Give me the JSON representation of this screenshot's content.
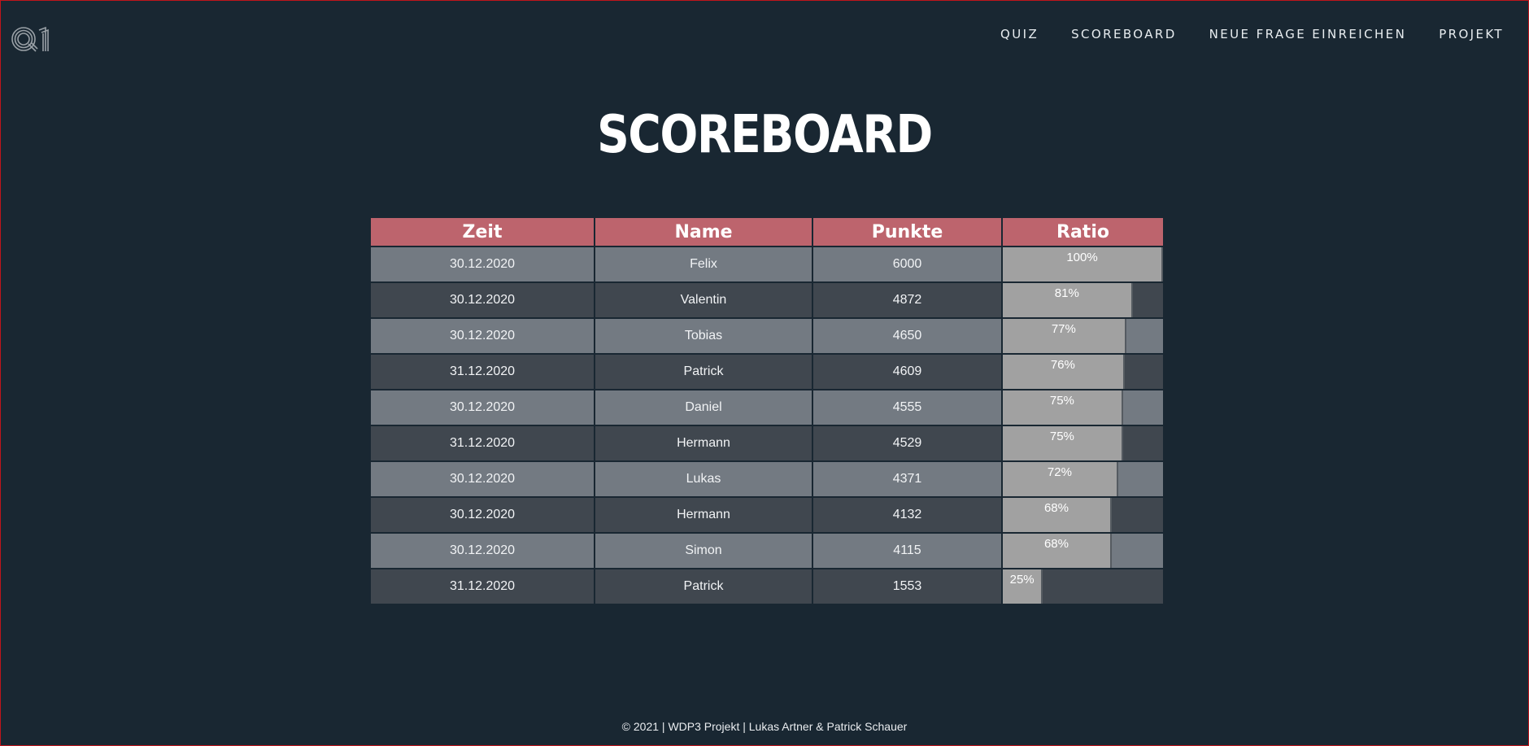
{
  "nav": {
    "logo_text": "Q1",
    "items": [
      {
        "label": "QUIZ"
      },
      {
        "label": "SCOREBOARD"
      },
      {
        "label": "NEUE FRAGE EINREICHEN"
      },
      {
        "label": "PROJEKT"
      }
    ]
  },
  "page": {
    "title": "SCOREBOARD"
  },
  "table": {
    "headers": [
      "Zeit",
      "Name",
      "Punkte",
      "Ratio"
    ],
    "rows": [
      {
        "time": "30.12.2020",
        "name": "Felix",
        "points": "6000",
        "ratio": 100,
        "ratio_label": "100%"
      },
      {
        "time": "30.12.2020",
        "name": "Valentin",
        "points": "4872",
        "ratio": 81,
        "ratio_label": "81%"
      },
      {
        "time": "30.12.2020",
        "name": "Tobias",
        "points": "4650",
        "ratio": 77,
        "ratio_label": "77%"
      },
      {
        "time": "31.12.2020",
        "name": "Patrick",
        "points": "4609",
        "ratio": 76,
        "ratio_label": "76%"
      },
      {
        "time": "30.12.2020",
        "name": "Daniel",
        "points": "4555",
        "ratio": 75,
        "ratio_label": "75%"
      },
      {
        "time": "31.12.2020",
        "name": "Hermann",
        "points": "4529",
        "ratio": 75,
        "ratio_label": "75%"
      },
      {
        "time": "30.12.2020",
        "name": "Lukas",
        "points": "4371",
        "ratio": 72,
        "ratio_label": "72%"
      },
      {
        "time": "30.12.2020",
        "name": "Hermann",
        "points": "4132",
        "ratio": 68,
        "ratio_label": "68%"
      },
      {
        "time": "30.12.2020",
        "name": "Simon",
        "points": "4115",
        "ratio": 68,
        "ratio_label": "68%"
      },
      {
        "time": "31.12.2020",
        "name": "Patrick",
        "points": "1553",
        "ratio": 25,
        "ratio_label": "25%"
      }
    ]
  },
  "footer": {
    "text": "© 2021 | WDP3 Projekt | Lukas Artner & Patrick Schauer"
  },
  "colors": {
    "background": "#192732",
    "header_bg": "#bd646d",
    "row_light": "#737a82",
    "row_dark": "#40474f",
    "bar": "#a1a1a1"
  }
}
